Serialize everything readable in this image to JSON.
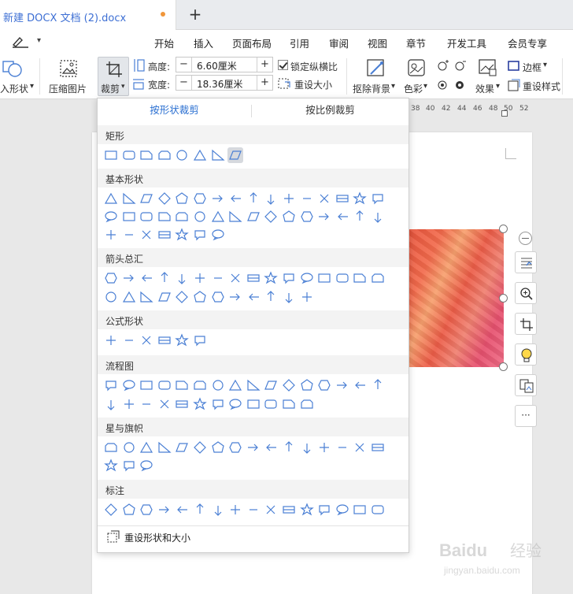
{
  "tabbar": {
    "doc_title": "新建 DOCX 文档 (2).docx",
    "new_tab_label": "+"
  },
  "menu": {
    "items": [
      "开始",
      "插入",
      "页面布局",
      "引用",
      "审阅",
      "视图",
      "章节",
      "开发工具",
      "会员专享"
    ],
    "dropdown_label": "▾"
  },
  "ribbon": {
    "change_shape_label": "入形状",
    "compress_label": "压缩图片",
    "crop_label": "裁剪",
    "height_label": "高度:",
    "height_value": "6.60厘米",
    "width_label": "宽度:",
    "width_value": "18.36厘米",
    "lock_ratio_label": "锁定纵横比",
    "reset_size_label": "重设大小",
    "remove_bg_label": "抠除背景",
    "color_label": "色彩",
    "effects_label": "效果",
    "border_label": "边框",
    "reset_style_label": "重设样式"
  },
  "ruler": {
    "numbers": [
      "38",
      "40",
      "42",
      "44",
      "46",
      "48",
      "50",
      "52"
    ]
  },
  "crop_panel": {
    "tab_shape": "按形状裁剪",
    "tab_ratio": "按比例裁剪",
    "active_tab_color": "#2a6fd1",
    "sections": [
      {
        "title": "矩形",
        "count": 8
      },
      {
        "title": "基本形状",
        "count": 39
      },
      {
        "title": "箭头总汇",
        "count": 28
      },
      {
        "title": "公式形状",
        "count": 6
      },
      {
        "title": "流程图",
        "count": 28
      },
      {
        "title": "星与旗帜",
        "count": 19
      },
      {
        "title": "标注",
        "count": 16
      }
    ],
    "reset_shape_label": "重设形状和大小"
  },
  "side_buttons": [
    "layout-icon",
    "zoom-icon",
    "crop-icon",
    "idea-icon",
    "convert-icon",
    "more-icon"
  ],
  "more_label": "···",
  "watermark": {
    "brand": "Baidu",
    "cn": "经验",
    "url": "jingyan.baidu.com"
  },
  "colors": {
    "accent_blue": "#2a6fd1",
    "shape_stroke": "#4a7fd4",
    "tab_dot": "#f0963a"
  }
}
